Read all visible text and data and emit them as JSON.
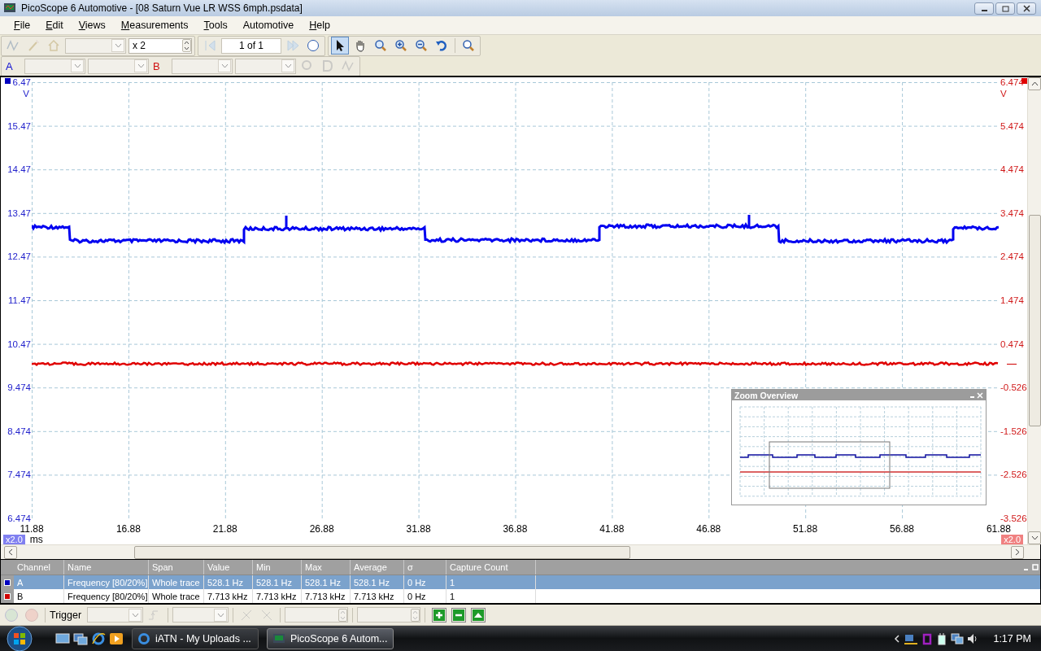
{
  "window": {
    "title": "PicoScope 6 Automotive - [08 Saturn Vue LR WSS 6mph.psdata]"
  },
  "menu": [
    {
      "accel": "F",
      "rest": "ile"
    },
    {
      "accel": "E",
      "rest": "dit"
    },
    {
      "accel": "V",
      "rest": "iews"
    },
    {
      "accel": "M",
      "rest": "easurements"
    },
    {
      "accel": "T",
      "rest": "ools"
    },
    {
      "rest": "Automotive"
    },
    {
      "accel": "H",
      "rest": "elp"
    }
  ],
  "toolbar": {
    "zoom_factor": "x 2",
    "page": "1 of 1",
    "view_tools": [
      {
        "kind": "pointer",
        "selected": true
      },
      {
        "kind": "hand",
        "selected": false
      },
      {
        "kind": "zoom-box",
        "selected": false
      },
      {
        "kind": "zoom-in",
        "selected": false
      },
      {
        "kind": "zoom-out",
        "selected": false
      }
    ]
  },
  "channel_buttons": [
    {
      "label": "A",
      "color": "#1010d0"
    },
    {
      "label": "B",
      "color": "#d01010"
    }
  ],
  "scope": {
    "left_axis": {
      "unit": "V",
      "ticks": [
        "6.47",
        "15.47",
        "14.47",
        "13.47",
        "12.47",
        "11.47",
        "10.47",
        "9.474",
        "8.474",
        "7.474",
        "6.474"
      ]
    },
    "right_axis": {
      "unit": "V",
      "ticks": [
        "6.474",
        "5.474",
        "4.474",
        "3.474",
        "2.474",
        "1.474",
        "0.474",
        "-0.526",
        "-1.526",
        "-2.526",
        "-3.526"
      ]
    },
    "x_axis": {
      "unit": "ms",
      "ticks": [
        "11.88",
        "16.88",
        "21.88",
        "26.88",
        "31.88",
        "36.88",
        "41.88",
        "46.88",
        "51.88",
        "56.88",
        "61.88"
      ]
    },
    "left_zoom": "x2.0",
    "right_zoom": "x2.0",
    "zoom_overview": {
      "title": "Zoom Overview"
    }
  },
  "measurements": {
    "columns": [
      "Channel",
      "Name",
      "Span",
      "Value",
      "Min",
      "Max",
      "Average",
      "σ",
      "Capture Count"
    ],
    "rows": [
      {
        "selected": true,
        "color": "#0000c0",
        "cells": [
          "A",
          "Frequency  [80/20%]",
          "Whole trace",
          "528.1 Hz",
          "528.1 Hz",
          "528.1 Hz",
          "528.1 Hz",
          "0 Hz",
          "1"
        ]
      },
      {
        "selected": false,
        "color": "#d00000",
        "cells": [
          "B",
          "Frequency  [80/20%]",
          "Whole trace",
          "7.713 kHz",
          "7.713 kHz",
          "7.713 kHz",
          "7.713 kHz",
          "0 Hz",
          "1"
        ]
      }
    ]
  },
  "trigger_bar": {
    "label": "Trigger"
  },
  "taskbar": {
    "tasks": [
      {
        "label": "iATN - My Uploads ...",
        "selected": false
      },
      {
        "label": "PicoScope 6 Autom...",
        "selected": true
      }
    ],
    "clock": "1:17 PM"
  }
}
